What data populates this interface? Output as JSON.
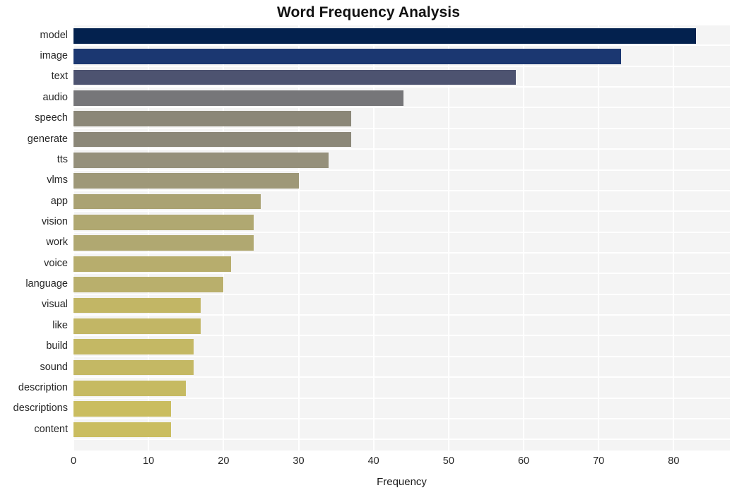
{
  "chart_data": {
    "type": "bar",
    "orientation": "horizontal",
    "title": "Word Frequency Analysis",
    "xlabel": "Frequency",
    "ylabel": "",
    "categories": [
      "model",
      "image",
      "text",
      "audio",
      "speech",
      "generate",
      "tts",
      "vlms",
      "app",
      "vision",
      "work",
      "voice",
      "language",
      "visual",
      "like",
      "build",
      "sound",
      "description",
      "descriptions",
      "content"
    ],
    "values": [
      83,
      73,
      59,
      44,
      37,
      37,
      34,
      30,
      25,
      24,
      24,
      21,
      20,
      17,
      17,
      16,
      16,
      15,
      13,
      13
    ],
    "bar_colors": [
      "#03214e",
      "#1b3771",
      "#4d5370",
      "#767679",
      "#8b8778",
      "#8b8778",
      "#95907b",
      "#9e9878",
      "#aaa273",
      "#b0a871",
      "#b0a871",
      "#b7ad6d",
      "#b9af6c",
      "#c2b665",
      "#c2b665",
      "#c4b864",
      "#c4b864",
      "#c6ba62",
      "#cabd60",
      "#cabd60"
    ],
    "xticks": [
      0,
      10,
      20,
      30,
      40,
      50,
      60,
      70,
      80
    ],
    "xlim": [
      0,
      87.5
    ],
    "grid": true,
    "grid_axis": "both",
    "grid_color": "#ffffff",
    "plot_background": "#f4f4f4",
    "figure_background": "#ffffff"
  }
}
